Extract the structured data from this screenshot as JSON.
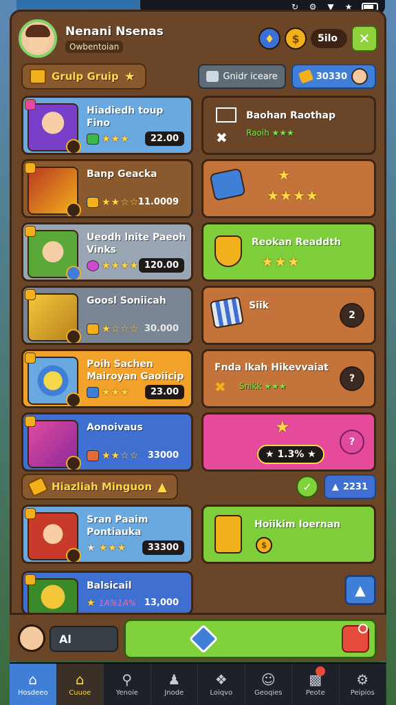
{
  "status_bar": {
    "icons": [
      "sync-icon",
      "settings-icon",
      "wifi-icon",
      "bluetooth-icon",
      "battery-icon"
    ]
  },
  "profile": {
    "name": "Nenani Nsenas",
    "subtitle": "Owbentoian"
  },
  "currency": {
    "amount": "5ilo"
  },
  "sections": {
    "top": {
      "title": "Grulp Gruip",
      "filter_label": "Gnidr iceare",
      "coins": "30330"
    },
    "bottom": {
      "title": "Hiazliah Minguon",
      "counter": "2231"
    }
  },
  "left_cards": [
    {
      "title": "Hiadiedh toup Fino",
      "price": "22.00",
      "color": "#6aa8e0"
    },
    {
      "title": "Banp Geacka",
      "price": "11.0009",
      "color": "#8a5a2e"
    },
    {
      "title": "Ueodh lnite Paeoh Vinks",
      "price": "120.00",
      "color": "#9aa6b4"
    },
    {
      "title": "Goosl Soniicah",
      "price": "30.000",
      "color": "#7a8694"
    },
    {
      "title": "Poih Sachen Mairoyan Gaoiicip",
      "price": "23.00",
      "color": "#f2a22a"
    },
    {
      "title": "Aonoivaus",
      "price": "33000",
      "color": "#3f6fd0"
    },
    {
      "title": "Sran Paaim Pontiauka",
      "price": "33300",
      "color": "#6aa8e0"
    },
    {
      "title": "Balsicail",
      "price": "13,000",
      "promo": "1A%1A%",
      "color": "#3f6fd0"
    }
  ],
  "right_cards": [
    {
      "title": "Baohan Raothap",
      "sub": "Raoih",
      "color": "#6b4527"
    },
    {
      "title": "",
      "color": "#c4743a"
    },
    {
      "title": "Reokan Readdth",
      "color": "#7fcf3c"
    },
    {
      "title": "Siik",
      "action": "2",
      "color": "#c4743a"
    },
    {
      "title": "Fnda lkah Hikevvaiat",
      "sub": "Snikk",
      "action": "?",
      "color": "#c4743a"
    },
    {
      "title": "",
      "pill": "1.3%",
      "action": "?",
      "color": "#e54b9a"
    },
    {
      "title": "Hoiikim Ioernan",
      "color": "#7fcf3c"
    }
  ],
  "action_bar": {
    "field_label": "Al"
  },
  "nav": [
    {
      "label": "Hosdeeo",
      "icon": "home-icon"
    },
    {
      "label": "Cuuoe",
      "icon": "shop-icon"
    },
    {
      "label": "Yenoie",
      "icon": "search-icon"
    },
    {
      "label": "Jnode",
      "icon": "player-icon"
    },
    {
      "label": "Loiqvo",
      "icon": "compass-icon"
    },
    {
      "label": "Geoqies",
      "icon": "profile-icon"
    },
    {
      "label": "Peote",
      "icon": "stats-icon"
    },
    {
      "label": "Peipios",
      "icon": "gear-icon"
    }
  ]
}
